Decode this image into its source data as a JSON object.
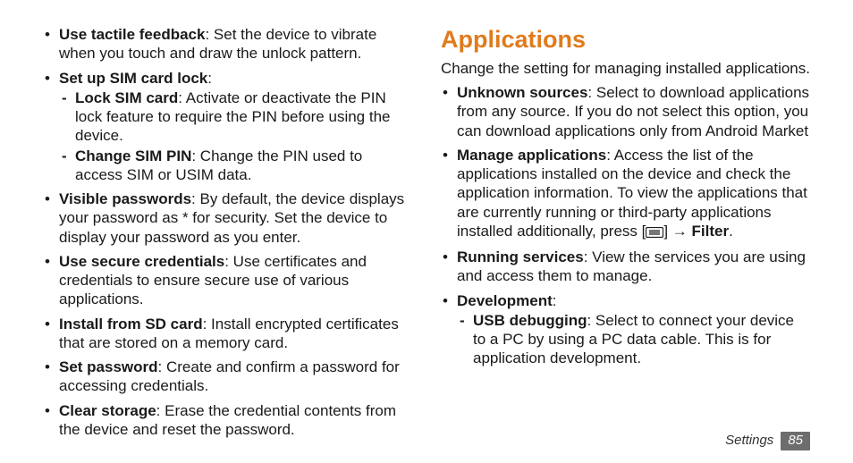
{
  "left": {
    "items": [
      {
        "term": "Use tactile feedback",
        "desc": ": Set the device to vibrate when you touch and draw the unlock pattern."
      },
      {
        "term": "Set up SIM card lock",
        "desc": ":",
        "sub": [
          {
            "term": "Lock SIM card",
            "desc": ": Activate or deactivate the PIN lock feature to require the PIN before using the device."
          },
          {
            "term": "Change SIM PIN",
            "desc": ": Change the PIN used to access SIM or USIM data."
          }
        ]
      },
      {
        "term": "Visible passwords",
        "desc": ": By default, the device displays your password as * for security. Set the device to display your password as you enter."
      },
      {
        "term": "Use secure credentials",
        "desc": ": Use certificates and credentials to ensure secure use of various applications."
      },
      {
        "term": "Install from SD card",
        "desc": ": Install encrypted certificates that are stored on a memory card."
      },
      {
        "term": "Set password",
        "desc": ": Create and confirm a password for accessing credentials."
      },
      {
        "term": "Clear storage",
        "desc": ": Erase the credential contents from the device and reset the password."
      }
    ]
  },
  "right": {
    "title": "Applications",
    "intro": "Change the setting for managing installed applications.",
    "items": [
      {
        "term": "Unknown sources",
        "desc": ": Select to download applications from any source. If you do not select this option, you can download applications only from Android Market"
      },
      {
        "term": "Manage applications",
        "desc_pre": ": Access the list of the applications installed on the device and check the application information. To view the applications that are currently running or third-party applications installed additionally, press [",
        "desc_mid": "] → ",
        "filter": "Filter",
        "desc_post": "."
      },
      {
        "term": "Running services",
        "desc": ": View the services you are using and access them to manage."
      },
      {
        "term": "Development",
        "desc": ":",
        "sub": [
          {
            "term": "USB debugging",
            "desc": ": Select to connect your device to a PC by using a PC data cable. This is for application development."
          }
        ]
      }
    ]
  },
  "footer": {
    "section": "Settings",
    "page": "85"
  }
}
